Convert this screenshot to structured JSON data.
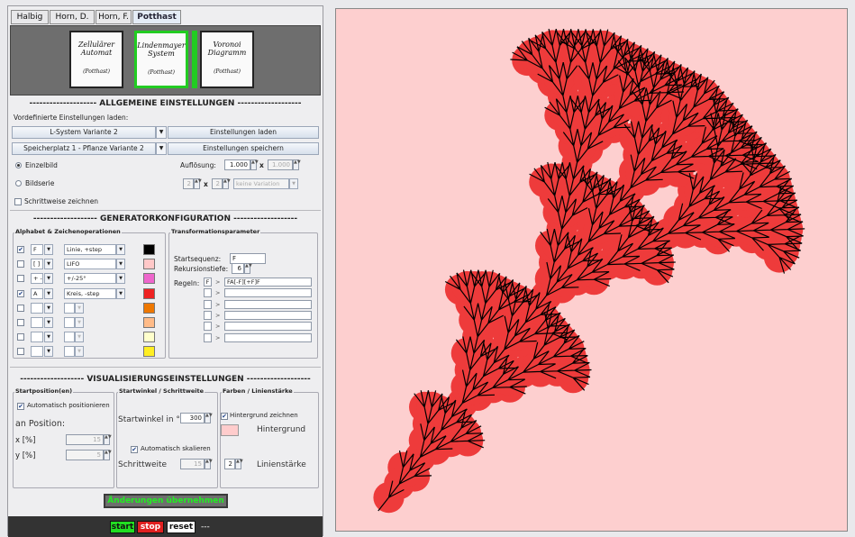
{
  "tabs": [
    "Halbig",
    "Horn, D.",
    "Horn, F.",
    "Potthast"
  ],
  "modes": [
    {
      "line1": "Zellulärer",
      "line2": "Automat",
      "sub": "(Potthast)"
    },
    {
      "line1": "Lindenmayer",
      "line2": "System",
      "sub": "(Potthast)"
    },
    {
      "line1": "Voronoi",
      "line2": "Diagramm",
      "sub": "(Potthast)"
    }
  ],
  "general": {
    "title": "-------------------- ALLGEMEINE EINSTELLUNGEN -------------------",
    "preset_label": "Vordefinierte Einstellungen laden:",
    "preset_value": "L-System Variante 2",
    "load_button": "Einstellungen laden",
    "slot_value": "Speicherplatz 1 - Pflanze Variante 2",
    "save_button": "Einstellungen speichern",
    "single": "Einzelbild",
    "series": "Bildserie",
    "stepwise": "Schrittweise zeichnen",
    "resolution_label": "Auflösung:",
    "res_w": "1.000",
    "times": "x",
    "res_h": "1.000",
    "series_a": "2",
    "series_b": "2",
    "variation": "keine Variation"
  },
  "generator": {
    "title": "------------------- GENERATORKONFIGURATION -------------------",
    "alphabet_title": "Alphabet & Zeichenoperationen",
    "rows": [
      {
        "checked": true,
        "symbol": "F",
        "op": "Linie, +step"
      },
      {
        "checked": false,
        "symbol": "[ ]",
        "op": "LIFO"
      },
      {
        "checked": false,
        "symbol": "+ -",
        "op": "+/-25°"
      },
      {
        "checked": true,
        "symbol": "A",
        "op": "Kreis, -step"
      },
      {
        "checked": false,
        "symbol": "",
        "op": ""
      },
      {
        "checked": false,
        "symbol": "",
        "op": ""
      },
      {
        "checked": false,
        "symbol": "",
        "op": ""
      },
      {
        "checked": false,
        "symbol": "",
        "op": ""
      }
    ],
    "colors": [
      "#000000",
      "#ffc8c8",
      "#ee66cc",
      "#ee2222",
      "#ee7700",
      "#ffbb88",
      "#ffffcc",
      "#ffee22"
    ],
    "transform_title": "Transformationsparameter",
    "start_label": "Startsequenz:",
    "start_value": "F",
    "depth_label": "Rekursionstiefe:",
    "depth_value": "6",
    "rules_label": "Regeln:",
    "rules": [
      {
        "left": "F",
        "arrow": ">",
        "right": "FA[-F][+F]F"
      },
      {
        "left": "",
        "arrow": ">",
        "right": ""
      },
      {
        "left": "",
        "arrow": ">",
        "right": ""
      },
      {
        "left": "",
        "arrow": ">",
        "right": ""
      },
      {
        "left": "",
        "arrow": ">",
        "right": ""
      },
      {
        "left": "",
        "arrow": ">",
        "right": ""
      }
    ]
  },
  "visual": {
    "title": "------------------- VISUALISIERUNGSEINSTELLUNGEN -------------------",
    "start_title": "Startposition(en)",
    "auto_pos": "Automatisch positionieren",
    "at_pos": "an Position:",
    "x_label": "x [%]",
    "x_value": "15",
    "y_label": "y [%]",
    "y_value": "5",
    "angle_title": "Startwinkel / Schrittweite",
    "angle_label": "Startwinkel in °",
    "angle_value": "300",
    "auto_scale": "Automatisch skalieren",
    "step_label": "Schrittweite",
    "step_value": "15",
    "colors_title": "Farben / Linienstärke",
    "bg_draw": "Hintergrund zeichnen",
    "bg_label": "Hintergrund",
    "bg_color": "#ffcccc",
    "line_value": "2",
    "line_label": "Linienstärke",
    "apply": "Änderungen übernehmen"
  },
  "controls": {
    "start": "start",
    "stop": "stop",
    "reset": "reset",
    "status": "---"
  },
  "canvas": {
    "background": "#fdcfcf",
    "fill": "#ee3b3b",
    "stroke": "#000000"
  }
}
